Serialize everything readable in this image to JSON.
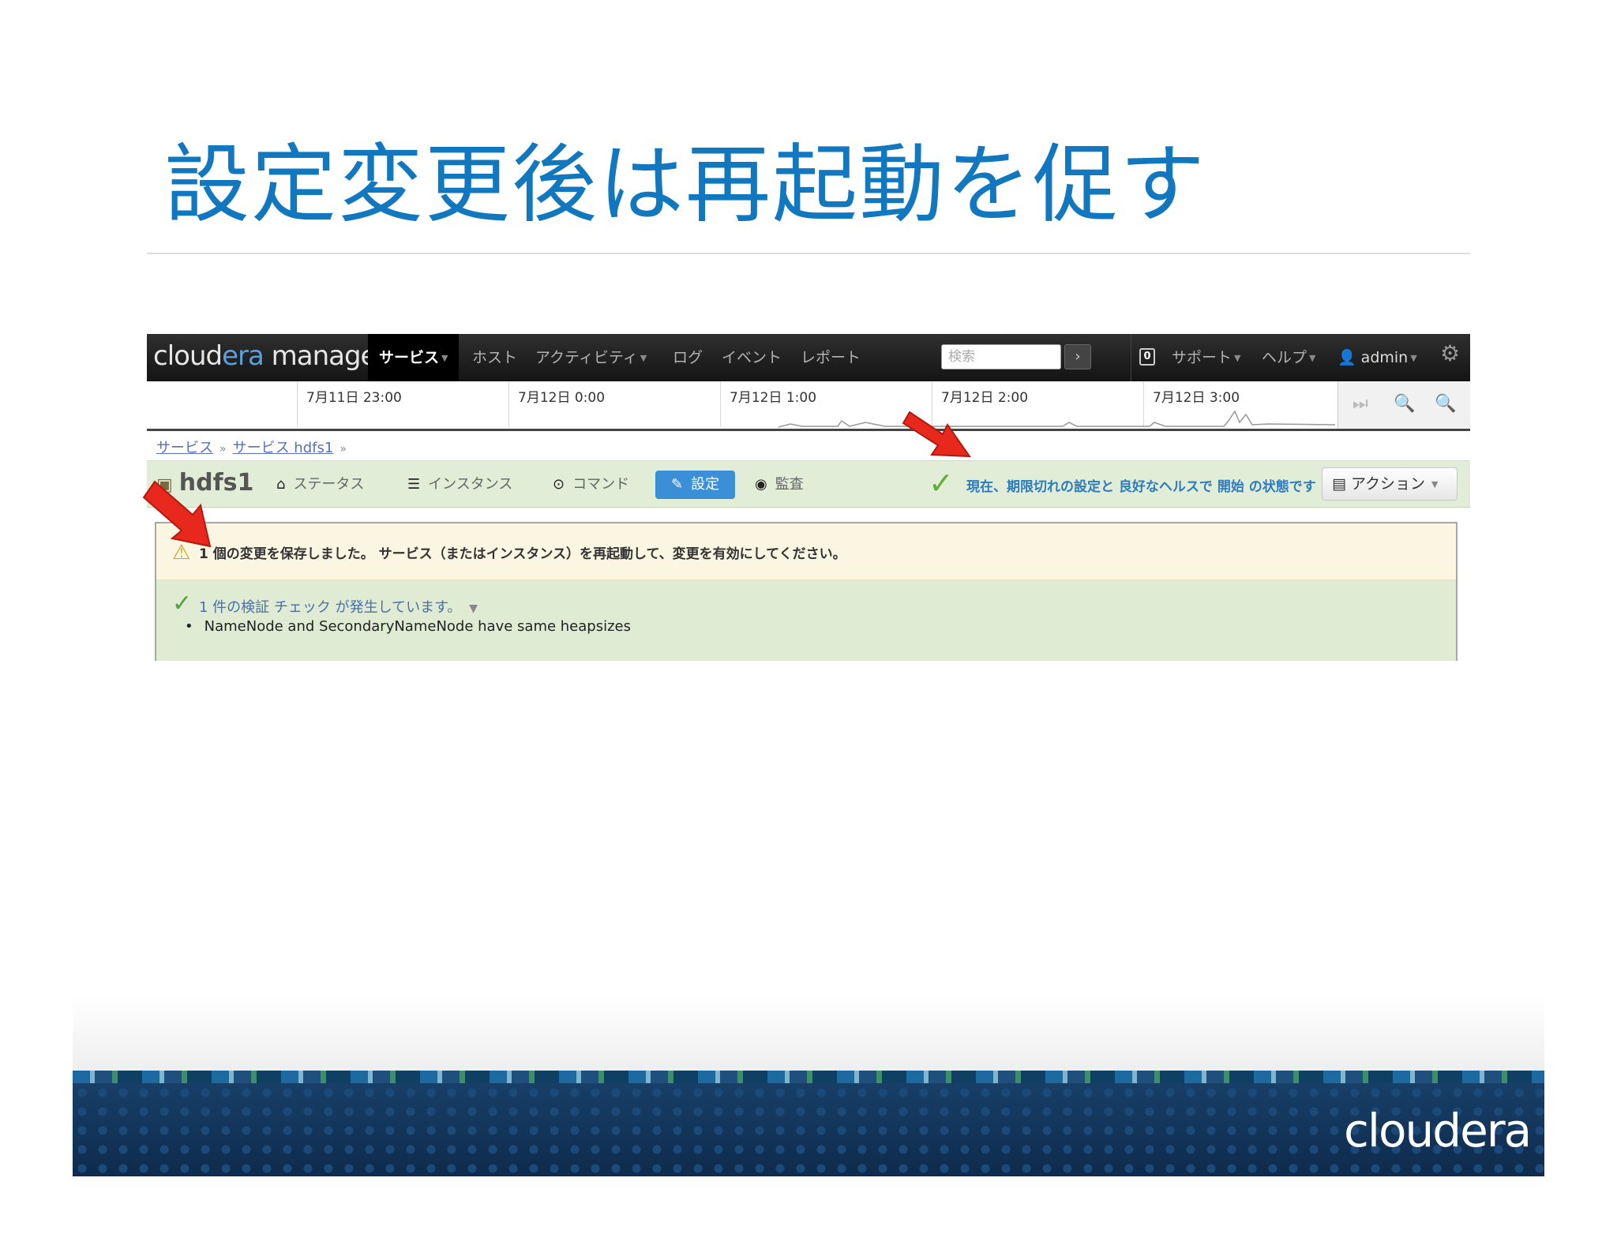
{
  "slide": {
    "title": "設定変更後は再起動を促す",
    "footer_logo": "cloudera"
  },
  "app": {
    "logo_main": "cloud",
    "logo_accent": "era",
    "logo_suffix": " manager",
    "nav": [
      {
        "label": "サービス",
        "active": true
      },
      {
        "label": "ホスト"
      },
      {
        "label": "アクティビティ"
      },
      {
        "label": "ログ"
      },
      {
        "label": "イベント"
      },
      {
        "label": "レポート"
      }
    ],
    "search_placeholder": "検索",
    "badge_count": "0",
    "support_label": "サポート",
    "help_label": "ヘルプ",
    "user_label": "admin"
  },
  "timeline": {
    "labels": [
      "7月11日 23:00",
      "7月12日 0:00",
      "7月12日 1:00",
      "7月12日 2:00",
      "7月12日 3:00"
    ]
  },
  "breadcrumb": {
    "items": [
      "サービス",
      "サービス hdfs1"
    ]
  },
  "service": {
    "name": "hdfs1",
    "tabs": [
      {
        "label": "ステータス",
        "icon": "home-icon"
      },
      {
        "label": "インスタンス",
        "icon": "list-icon"
      },
      {
        "label": "コマンド",
        "icon": "play-circle-icon"
      },
      {
        "label": "設定",
        "icon": "edit-icon",
        "active": true
      },
      {
        "label": "監査",
        "icon": "eye-icon"
      }
    ],
    "health_text": "現在、期限切れの設定と 良好なヘルスで 開始 の状態です",
    "actions_label": "アクション"
  },
  "notices": {
    "warning": "1 個の変更を保存しました。 サービス（またはインスタンス）を再起動して、変更を有効にしてください。",
    "validation_title": "1 件の検証 チェック が発生しています。",
    "validation_items": [
      "NameNode and SecondaryNameNode have same heapsizes"
    ]
  },
  "colors": {
    "title_blue": "#1178bf",
    "arrow_red": "#e8281c",
    "config_tab_blue": "#3b8fd6",
    "service_bar_green": "#e2edd7",
    "footer_navy": "#12335a"
  }
}
